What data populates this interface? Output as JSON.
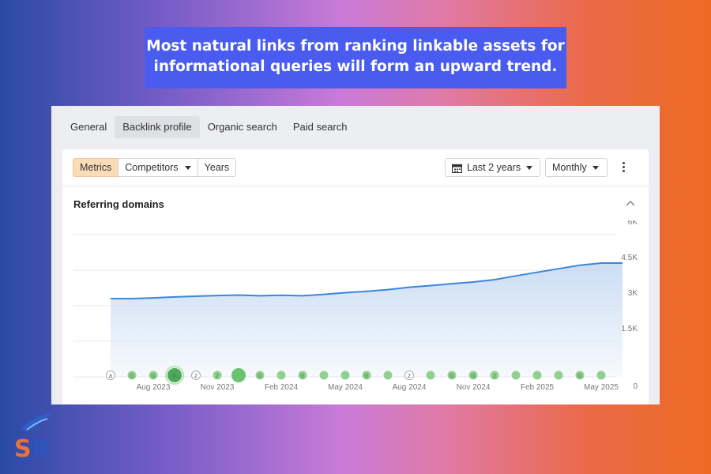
{
  "banner": {
    "line1": "Most natural links from ranking linkable assets for",
    "line2": "informational queries will form an upward trend."
  },
  "tabs": [
    "General",
    "Backlink profile",
    "Organic search",
    "Paid search"
  ],
  "active_tab": "Backlink profile",
  "toolbar": {
    "segments": [
      "Metrics",
      "Competitors",
      "Years"
    ],
    "active_segment": "Metrics",
    "date_range": "Last 2 years",
    "interval": "Monthly"
  },
  "section": {
    "title": "Referring domains"
  },
  "logo_text": "SR",
  "colors": {
    "line": "#3d86d8",
    "fill": "#c9dcf3",
    "marker": "#8fd28f",
    "marker_dark": "#4da85a",
    "accent_segment": "#fbdcb8",
    "banner": "#4a5cf0"
  },
  "chart_data": {
    "type": "area",
    "ylabel": "",
    "xlabel": "",
    "ylim": [
      0,
      6000
    ],
    "y_ticks": [
      0,
      1500,
      3000,
      4500,
      6000
    ],
    "y_tick_labels": [
      "0",
      "1.5K",
      "3K",
      "4.5K",
      "6K"
    ],
    "x_tick_labels": [
      "Aug 2023",
      "Nov 2023",
      "Feb 2024",
      "May 2024",
      "Aug 2024",
      "Nov 2024",
      "Feb 2025",
      "May 2025"
    ],
    "x": [
      "Jun 2023",
      "Jul 2023",
      "Aug 2023",
      "Sep 2023",
      "Oct 2023",
      "Nov 2023",
      "Dec 2023",
      "Jan 2024",
      "Feb 2024",
      "Mar 2024",
      "Apr 2024",
      "May 2024",
      "Jun 2024",
      "Jul 2024",
      "Aug 2024",
      "Sep 2024",
      "Oct 2024",
      "Nov 2024",
      "Dec 2024",
      "Jan 2025",
      "Feb 2025",
      "Mar 2025",
      "Apr 2025",
      "May 2025",
      "Jun 2025"
    ],
    "series": [
      {
        "values": [
          3300,
          3300,
          3330,
          3370,
          3400,
          3430,
          3450,
          3420,
          3440,
          3420,
          3480,
          3550,
          3610,
          3680,
          3780,
          3850,
          3930,
          4000,
          4100,
          4260,
          4410,
          4560,
          4710,
          4800,
          4800
        ]
      }
    ],
    "grid": true,
    "events": {
      "x": [
        "Jun 2023",
        "Jul 2023",
        "Aug 2023",
        "Sep 2023",
        "Oct 2023",
        "Nov 2023",
        "Dec 2023",
        "Jan 2024",
        "Feb 2024",
        "Mar 2024",
        "Apr 2024",
        "May 2024",
        "Jun 2024",
        "Jul 2024",
        "Aug 2024",
        "Sep 2024",
        "Oct 2024",
        "Nov 2024",
        "Dec 2024",
        "Jan 2025",
        "Feb 2025",
        "Mar 2025",
        "Apr 2025",
        "May 2025"
      ],
      "labels": [
        "a",
        "G",
        "G",
        "G",
        "2",
        "2",
        "",
        "G",
        "",
        "G",
        "",
        "",
        "G",
        "",
        "2",
        "",
        "G",
        "G",
        "2",
        "",
        "",
        "",
        "G",
        ""
      ],
      "kind": [
        "outline",
        "small",
        "small",
        "big",
        "outline",
        "small",
        "big",
        "small",
        "small",
        "small",
        "small",
        "small",
        "small",
        "small",
        "outline",
        "small",
        "small",
        "small",
        "small",
        "small",
        "small",
        "small",
        "small",
        "small"
      ]
    }
  }
}
